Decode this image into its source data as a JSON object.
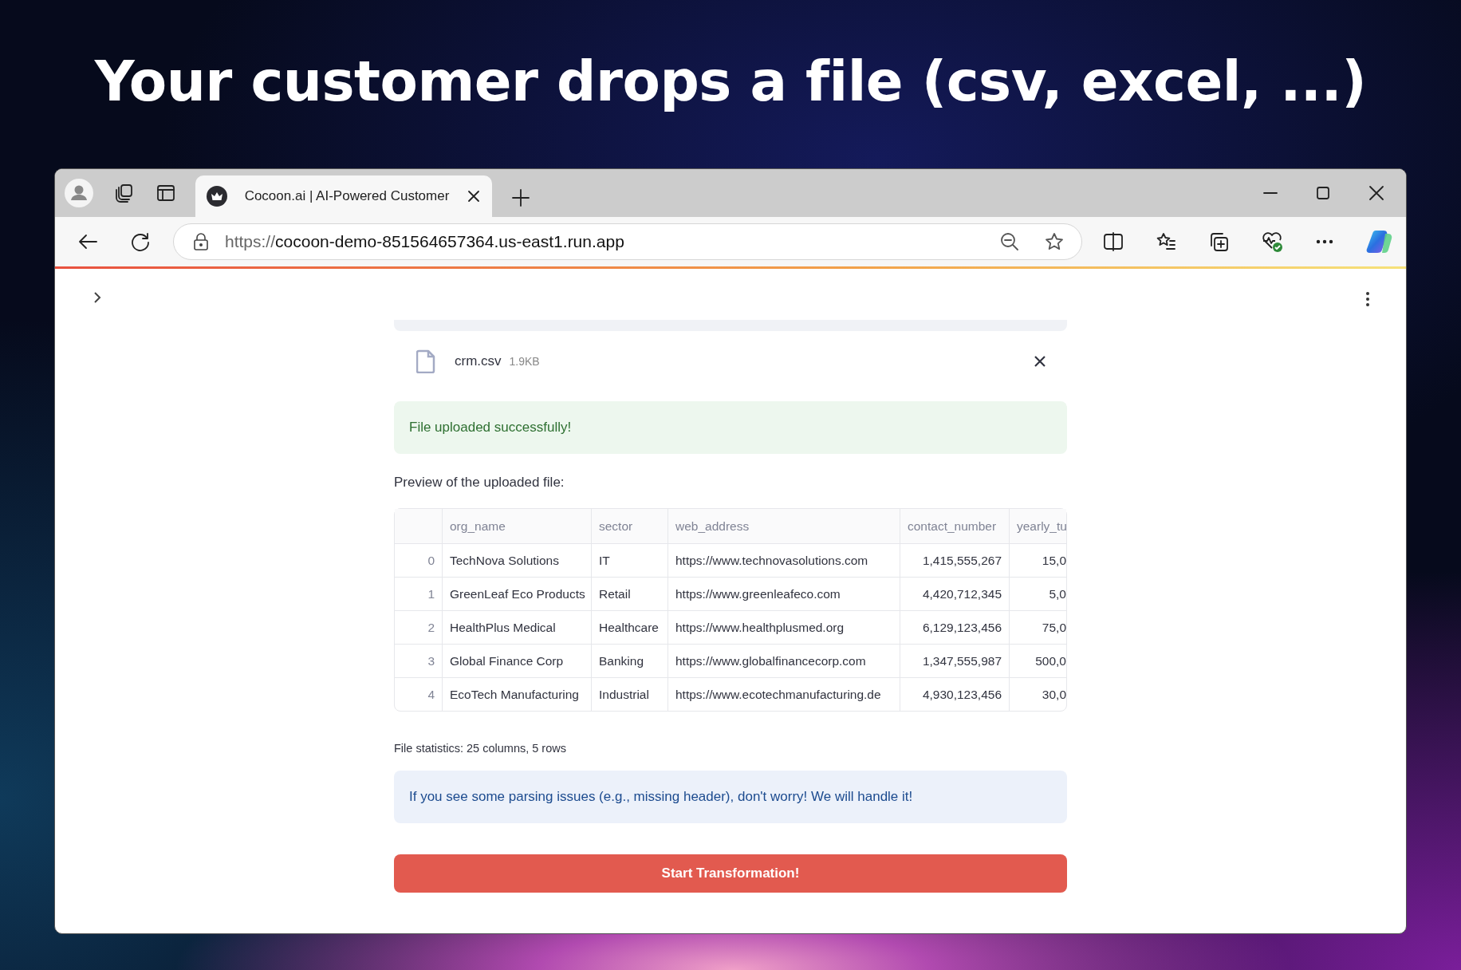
{
  "headline": "Your customer drops a file (csv, excel, ...)",
  "browser": {
    "tabs": [
      {
        "title": "Cocoon.ai | AI-Powered Customer",
        "selected": true
      }
    ],
    "url_scheme": "https://",
    "url_host": "cocoon-demo-851564657364.us-east1.run.app"
  },
  "upload": {
    "file_name": "crm.csv",
    "file_size": "1.9KB"
  },
  "success_message": "File uploaded successfully!",
  "preview_label": "Preview of the uploaded file:",
  "table": {
    "columns": [
      "org_name",
      "sector",
      "web_address",
      "contact_number",
      "yearly_tu"
    ],
    "rows": [
      {
        "index": "0",
        "cells": [
          "TechNova Solutions",
          "IT",
          "https://www.technovasolutions.com",
          "1,415,555,267",
          "15,0"
        ]
      },
      {
        "index": "1",
        "cells": [
          "GreenLeaf Eco Products",
          "Retail",
          "https://www.greenleafeco.com",
          "4,420,712,345",
          "5,0"
        ]
      },
      {
        "index": "2",
        "cells": [
          "HealthPlus Medical",
          "Healthcare",
          "https://www.healthplusmed.org",
          "6,129,123,456",
          "75,0"
        ]
      },
      {
        "index": "3",
        "cells": [
          "Global Finance Corp",
          "Banking",
          "https://www.globalfinancecorp.com",
          "1,347,555,987",
          "500,0"
        ]
      },
      {
        "index": "4",
        "cells": [
          "EcoTech Manufacturing",
          "Industrial",
          "https://www.ecotechmanufacturing.de",
          "4,930,123,456",
          "30,0"
        ]
      }
    ]
  },
  "stats": "File statistics: 25 columns, 5 rows",
  "info_message": "If you see some parsing issues (e.g., missing header), don't worry! We will handle it!",
  "primary_button": "Start Transformation!"
}
